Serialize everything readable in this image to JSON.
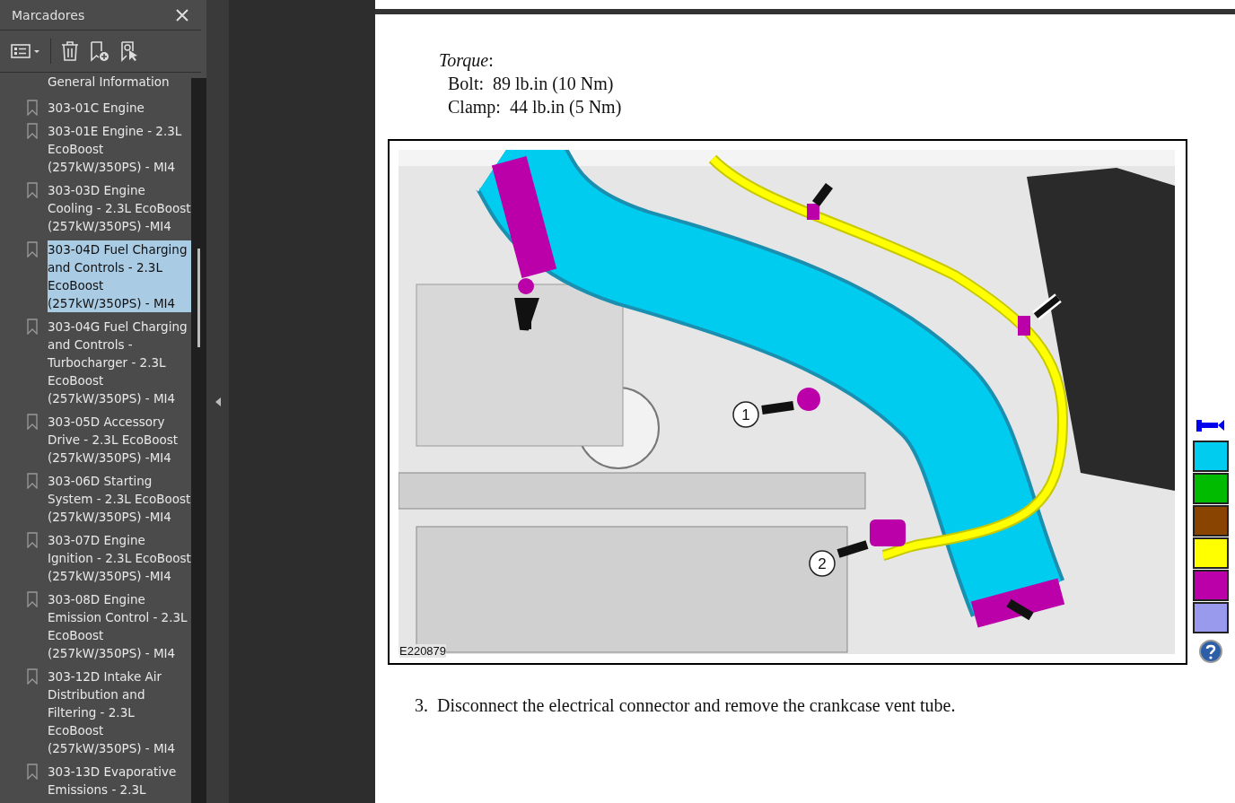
{
  "sidebar": {
    "title": "Marcadores",
    "partial_item": "General Information",
    "items": [
      {
        "label": "303-01C Engine",
        "selected": false
      },
      {
        "label": "303-01E Engine - 2.3L EcoBoost (257kW/350PS) - MI4",
        "selected": false
      },
      {
        "label": "303-03D Engine Cooling - 2.3L EcoBoost (257kW/350PS) -MI4",
        "selected": false
      },
      {
        "label": "303-04D Fuel Charging and Controls - 2.3L EcoBoost (257kW/350PS) - MI4",
        "selected": true
      },
      {
        "label": "303-04G Fuel Charging and Controls - Turbocharger - 2.3L EcoBoost (257kW/350PS) - MI4",
        "selected": false
      },
      {
        "label": "303-05D Accessory Drive - 2.3L EcoBoost (257kW/350PS) -MI4",
        "selected": false
      },
      {
        "label": "303-06D Starting System - 2.3L EcoBoost (257kW/350PS) -MI4",
        "selected": false
      },
      {
        "label": "303-07D Engine Ignition - 2.3L EcoBoost (257kW/350PS) -MI4",
        "selected": false
      },
      {
        "label": "303-08D Engine Emission Control - 2.3L EcoBoost (257kW/350PS) - MI4",
        "selected": false
      },
      {
        "label": "303-12D Intake Air Distribution and Filtering - 2.3L EcoBoost (257kW/350PS) - MI4",
        "selected": false
      },
      {
        "label": "303-13D Evaporative Emissions - 2.3L",
        "selected": false
      }
    ]
  },
  "document": {
    "torque": {
      "heading": "*Torque*:",
      "rows": [
        {
          "name": "Bolt:",
          "value": "89 lb.in (10 Nm)"
        },
        {
          "name": "Clamp:",
          "value": "44 lb.in (5 Nm)"
        }
      ]
    },
    "figure": {
      "callouts": [
        "1",
        "2"
      ],
      "code": "E220879"
    },
    "legend": [
      {
        "color": "#00ccf0"
      },
      {
        "color": "#00bb00"
      },
      {
        "color": "#884400"
      },
      {
        "color": "#ffff00"
      },
      {
        "color": "#bb00aa"
      },
      {
        "color": "#9999ee"
      }
    ],
    "step": {
      "number": "3.",
      "text": "Disconnect the electrical connector and remove the crankcase vent tube."
    }
  }
}
